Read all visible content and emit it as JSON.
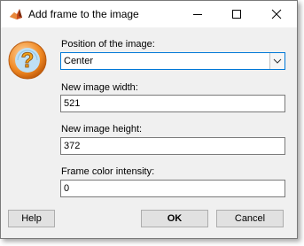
{
  "window": {
    "title": "Add frame to the image"
  },
  "fields": {
    "position": {
      "label": "Position of the image:",
      "value": "Center"
    },
    "width": {
      "label": "New image width:",
      "value": "521"
    },
    "height": {
      "label": "New image height:",
      "value": "372"
    },
    "intensity": {
      "label": "Frame color intensity:",
      "value": "0"
    }
  },
  "buttons": {
    "help": "Help",
    "ok": "OK",
    "cancel": "Cancel"
  },
  "icons": {
    "app": "matlab-icon",
    "dialog": "question-icon",
    "minimize": "minimize-icon",
    "maximize": "maximize-icon",
    "close": "close-icon",
    "dropdown": "chevron-down-icon"
  },
  "colors": {
    "focus_border": "#0078d7",
    "question_icon": "#f08a24"
  }
}
